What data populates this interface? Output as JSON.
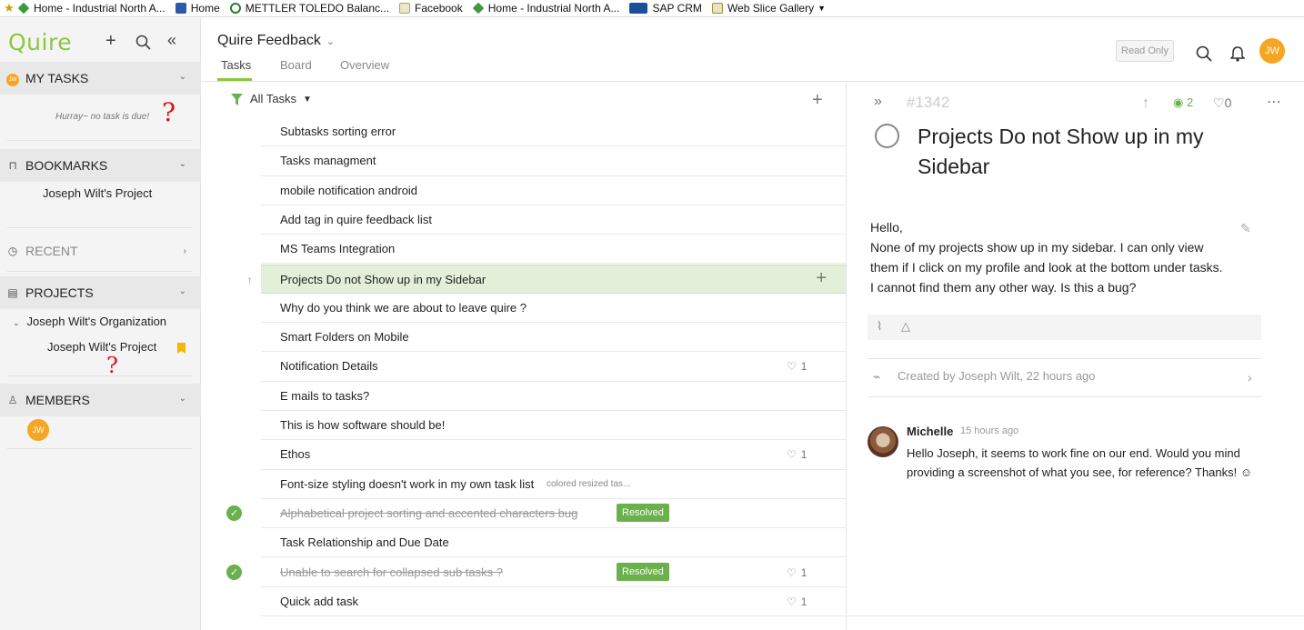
{
  "favorites": [
    {
      "label": "Home - Industrial North A...",
      "icon": "green-diamond-icon"
    },
    {
      "label": "Home",
      "icon": "blue-page-icon"
    },
    {
      "label": "METTLER TOLEDO Balanc...",
      "icon": "mettler-icon"
    },
    {
      "label": "Facebook",
      "icon": "ie-page-icon"
    },
    {
      "label": "Home - Industrial North A...",
      "icon": "green-diamond-icon"
    },
    {
      "label": "SAP CRM",
      "icon": "sap-icon"
    },
    {
      "label": "Web Slice Gallery",
      "icon": "ie-page-icon"
    }
  ],
  "sidebar": {
    "logo": "Quire",
    "my_tasks": {
      "label": "MY TASKS",
      "avatar": "JW",
      "empty": "Hurray~ no task is due!"
    },
    "bookmarks": {
      "label": "BOOKMARKS",
      "items": [
        "Joseph Wilt's Project"
      ]
    },
    "recent": {
      "label": "RECENT"
    },
    "projects": {
      "label": "PROJECTS",
      "org": "Joseph Wilt's Organization",
      "project": "Joseph Wilt's Project"
    },
    "members": {
      "label": "MEMBERS",
      "avatar": "JW"
    },
    "annotation": "?"
  },
  "header": {
    "project_title": "Quire Feedback",
    "tabs": [
      "Tasks",
      "Board",
      "Overview"
    ],
    "read_only": "Read Only",
    "avatar": "JW"
  },
  "list": {
    "filter": "All Tasks",
    "tasks": [
      {
        "title": "Subtasks sorting error"
      },
      {
        "title": "Tasks managment"
      },
      {
        "title": "mobile notification android"
      },
      {
        "title": "Add tag in quire feedback list"
      },
      {
        "title": "MS Teams Integration"
      },
      {
        "title": "Projects Do not Show up in my Sidebar",
        "selected": true
      },
      {
        "title": "Why do you think we are about to leave quire ?"
      },
      {
        "title": "Smart Folders on Mobile"
      },
      {
        "title": "Notification Details",
        "likes": "1"
      },
      {
        "title": "E mails to tasks?"
      },
      {
        "title": "This is how software should be!"
      },
      {
        "title": "Ethos",
        "likes": "1"
      },
      {
        "title": "Font-size styling doesn't work in my own task list",
        "subtitle": "colored resized tas..."
      },
      {
        "title": "Alphabetical project sorting and accented characters bug",
        "done": true,
        "badge": "Resolved"
      },
      {
        "title": "Task Relationship and Due Date"
      },
      {
        "title": "Unable to search for collapsed sub tasks ?",
        "done": true,
        "badge": "Resolved",
        "likes": "1"
      },
      {
        "title": "Quick add task",
        "likes": "1"
      }
    ]
  },
  "detail": {
    "id": "#1342",
    "watchers": "2",
    "likes": "0",
    "title": "Projects Do not Show up in my Sidebar",
    "description": [
      "Hello,",
      "None of my projects show up in my sidebar.  I can only view",
      "them if I click on my profile and look at the bottom under tasks.",
      "I cannot find them any other way.  Is this a bug?"
    ],
    "created": "Created by Joseph Wilt, 22 hours ago",
    "comment": {
      "author": "Michelle",
      "time": "15 hours ago",
      "text": "Hello Joseph, it seems to work fine on our end. Would you mind providing a screenshot of what you see, for reference? Thanks! ☺"
    }
  },
  "colors": {
    "brand": "#8cc63f",
    "resolved": "#6ab04c",
    "avatar": "#f5a623",
    "selected_row": "#e3efd8"
  }
}
